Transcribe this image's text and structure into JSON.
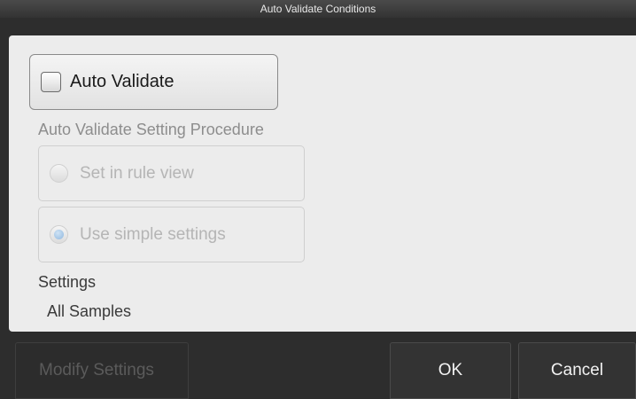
{
  "window": {
    "title": "Auto Validate Conditions"
  },
  "auto_validate": {
    "label": "Auto Validate",
    "checked": false
  },
  "procedure": {
    "title": "Auto Validate Setting Procedure",
    "options": [
      {
        "label": "Set in rule view",
        "selected": false,
        "enabled": false
      },
      {
        "label": "Use simple settings",
        "selected": true,
        "enabled": false
      }
    ]
  },
  "settings": {
    "label": "Settings",
    "value": "All Samples"
  },
  "footer": {
    "modify_label": "Modify Settings",
    "ok_label": "OK",
    "cancel_label": "Cancel"
  },
  "colors": {
    "titlebar": "#3a3a3a",
    "panel": "#ececec",
    "frame": "#2d2d2d",
    "radio_selected": "#8fb7de"
  }
}
